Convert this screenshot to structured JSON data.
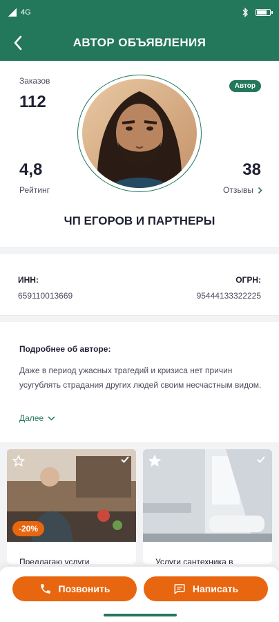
{
  "status_bar": {
    "network": "4G",
    "colors": {
      "bar": "#23775a"
    }
  },
  "header": {
    "title": "АВТОР ОБЪЯВЛЕНИЯ"
  },
  "profile": {
    "orders_label": "Заказов",
    "orders_value": "112",
    "rating_value": "4,8",
    "rating_label": "Рейтинг",
    "reviews_value": "38",
    "reviews_label": "Отзывы",
    "badge": "Автор",
    "company": "ЧП ЕГОРОВ И ПАРТНЕРЫ"
  },
  "ids": {
    "inn_label": "ИНН:",
    "inn_value": "659110013669",
    "ogrn_label": "ОГРН:",
    "ogrn_value": "95444133322225"
  },
  "about": {
    "heading": "Подробнее об авторе:",
    "text": "Даже в период ужасных трагедий и кризиса нет причин усугублять страдания других людей своим несчастным видом.",
    "more_label": "Далее"
  },
  "cards": [
    {
      "title": "Предлагаю услуги",
      "discount": "-20%",
      "favorite": false
    },
    {
      "title": "Услуги сантехника в",
      "favorite": true
    }
  ],
  "actions": {
    "call_label": "Позвонить",
    "write_label": "Написать"
  },
  "colors": {
    "brand": "#23775a",
    "accent": "#e8660f",
    "text": "#1f2133"
  }
}
